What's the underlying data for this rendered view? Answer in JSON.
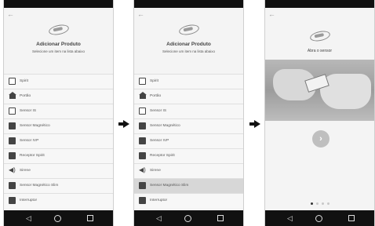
{
  "screens": [
    {
      "back": "←",
      "title": "Adicionar Produto",
      "subtitle": "Selecione um item na lista abaixo",
      "items": [
        {
          "label": "Spirit",
          "icon": "spirit-icon"
        },
        {
          "label": "Portão",
          "icon": "gate-icon"
        },
        {
          "label": "Sensor IS",
          "icon": "sensor-is-icon"
        },
        {
          "label": "Sensor Magnético",
          "icon": "magnetic-sensor-icon"
        },
        {
          "label": "Sensor IVP",
          "icon": "ivp-sensor-icon"
        },
        {
          "label": "Receptor Spirit",
          "icon": "receiver-icon"
        },
        {
          "label": "Sirene",
          "icon": "siren-icon"
        },
        {
          "label": "Sensor Magnético Slim",
          "icon": "magnetic-slim-icon"
        },
        {
          "label": "Interruptor",
          "icon": "switch-icon"
        }
      ]
    },
    {
      "back": "←",
      "title": "Adicionar Produto",
      "subtitle": "Selecione um item na lista abaixo",
      "selected_index": 7,
      "items": [
        {
          "label": "Spirit",
          "icon": "spirit-icon"
        },
        {
          "label": "Portão",
          "icon": "gate-icon"
        },
        {
          "label": "Sensor IS",
          "icon": "sensor-is-icon"
        },
        {
          "label": "Sensor Magnético",
          "icon": "magnetic-sensor-icon"
        },
        {
          "label": "Sensor IVP",
          "icon": "ivp-sensor-icon"
        },
        {
          "label": "Receptor Spirit",
          "icon": "receiver-icon"
        },
        {
          "label": "Sirene",
          "icon": "siren-icon"
        },
        {
          "label": "Sensor Magnético Slim",
          "icon": "magnetic-slim-icon"
        },
        {
          "label": "Interruptor",
          "icon": "switch-icon"
        }
      ]
    },
    {
      "back": "←",
      "title": "Abra o sensor",
      "next": "›",
      "pager": {
        "total": 4,
        "active": 0
      }
    }
  ]
}
